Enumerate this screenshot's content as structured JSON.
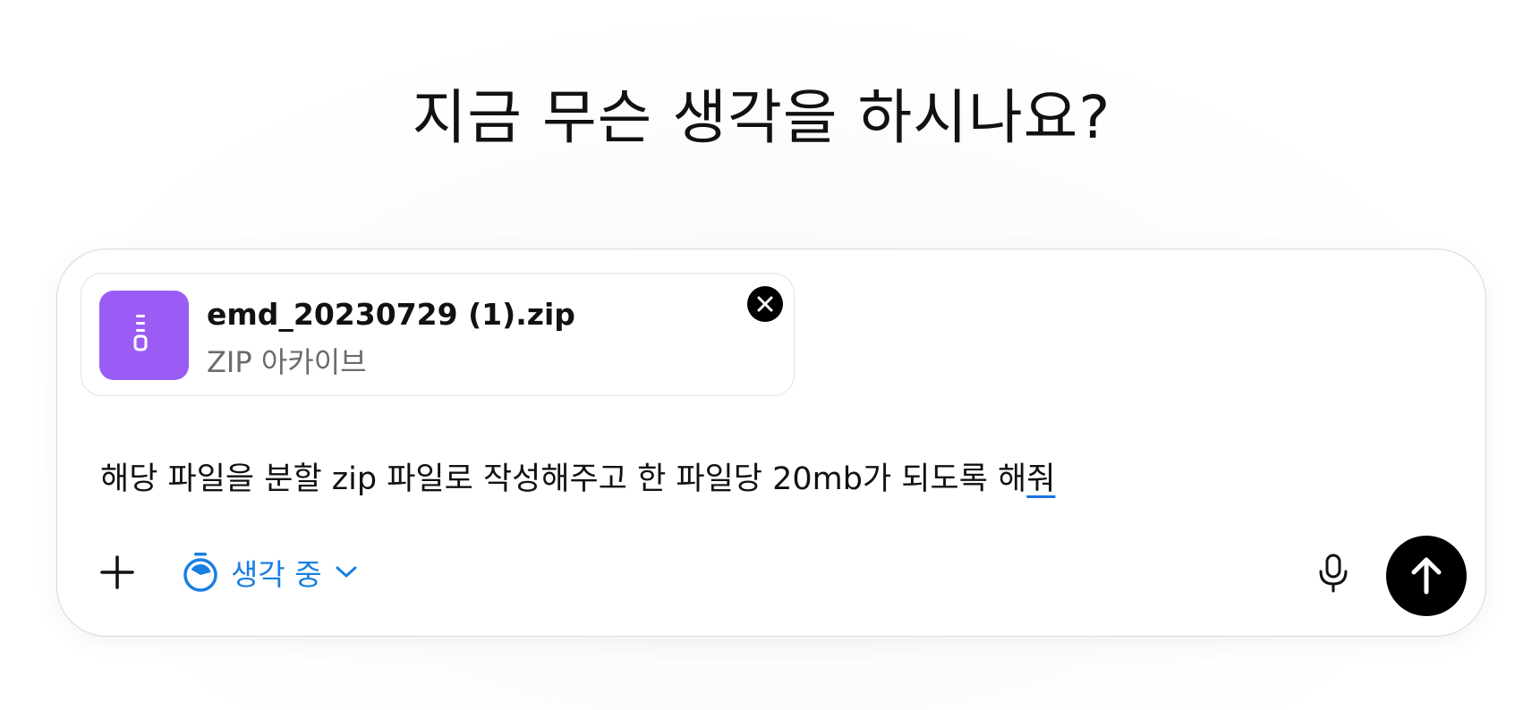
{
  "page": {
    "heading": "지금 무슨 생각을 하시나요?"
  },
  "attachment": {
    "file_name": "emd_20230729 (1).zip",
    "file_type": "ZIP 아카이브",
    "icon": "zip-file-icon",
    "icon_color": "#9b5cf6",
    "remove_icon": "close-icon"
  },
  "composer": {
    "prompt_text_main": "해당 파일을 분할 zip 파일로 작성해주고 한 파일당 20mb가 되도록 해",
    "prompt_text_underlined": "줘"
  },
  "toolbar": {
    "add_icon": "plus-icon",
    "mode_icon": "timer-icon",
    "mode_label": "생각 중",
    "mode_chevron": "chevron-down-icon",
    "mode_color": "#1a7fe0",
    "mic_icon": "microphone-icon",
    "send_icon": "arrow-up-icon"
  }
}
